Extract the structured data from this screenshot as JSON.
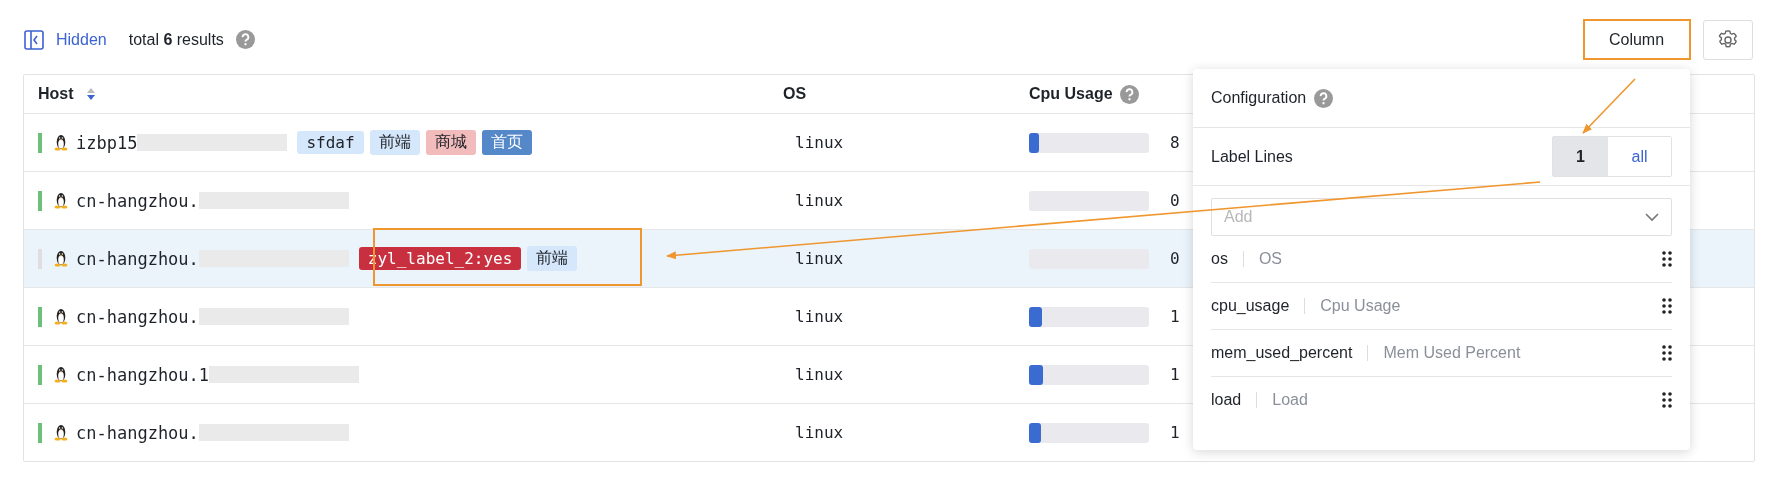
{
  "toolbar": {
    "hidden_label": "Hidden",
    "summary": "total **6** results",
    "summary_help": true,
    "column_button": "Column"
  },
  "table": {
    "columns": [
      {
        "label": "Host",
        "sorted": true,
        "help": false
      },
      {
        "label": "OS",
        "sorted": false,
        "help": false
      },
      {
        "label": "Cpu Usage",
        "sorted": false,
        "help": true
      }
    ],
    "rows": [
      {
        "color": "#6cc07a",
        "host": "izbp15",
        "tags": [
          {
            "text": "sfdaf",
            "color": "#d5e7fb"
          },
          {
            "text": "前端",
            "color": "#d5e7fb"
          },
          {
            "text": "商城",
            "color": "#f2bcbc"
          },
          {
            "text": "首页",
            "color": "#5588c8"
          }
        ],
        "os": "linux",
        "cpu": {
          "level": 0.08,
          "value": "8"
        },
        "selected": false
      },
      {
        "color": "#6cc07a",
        "host": "cn-hangzhou.",
        "tags": [],
        "os": "linux",
        "cpu": {
          "level": 0,
          "value": "0"
        },
        "selected": false
      },
      {
        "color": "#e0dde2",
        "host": "cn-hangzhou.",
        "tags": [
          {
            "text": "zyl_label_2:yes",
            "color": "#c8303f"
          },
          {
            "text": "前端",
            "color": "#d5e7fb"
          }
        ],
        "os": "linux",
        "cpu": {
          "level": 0,
          "value": "0"
        },
        "selected": true
      },
      {
        "color": "#6cc07a",
        "host": "cn-hangzhou.",
        "tags": [],
        "os": "linux",
        "cpu": {
          "level": 0.11,
          "value": "1"
        },
        "selected": false
      },
      {
        "color": "#6cc07a",
        "host": "cn-hangzhou.1",
        "tags": [],
        "os": "linux",
        "cpu": {
          "level": 0.12,
          "value": "1"
        },
        "selected": false
      },
      {
        "color": "#6cc07a",
        "host": "cn-hangzhou.",
        "tags": [],
        "os": "linux",
        "cpu": {
          "level": 0.1,
          "value": "1"
        },
        "selected": false
      }
    ]
  },
  "popover": {
    "title": "Configuration",
    "title_help": true,
    "label_lines": {
      "label": "Label Lines",
      "options": [
        {
          "label": "1",
          "selected": true
        },
        {
          "label": "all",
          "selected": false
        }
      ]
    },
    "add_select": {
      "placeholder": "Add"
    },
    "columns": [
      {
        "key": "os",
        "label": "OS"
      },
      {
        "key": "cpu_usage",
        "label": "Cpu Usage"
      },
      {
        "key": "mem_used_percent",
        "label": "Mem Used Percent"
      },
      {
        "key": "load",
        "label": "Load"
      }
    ]
  }
}
